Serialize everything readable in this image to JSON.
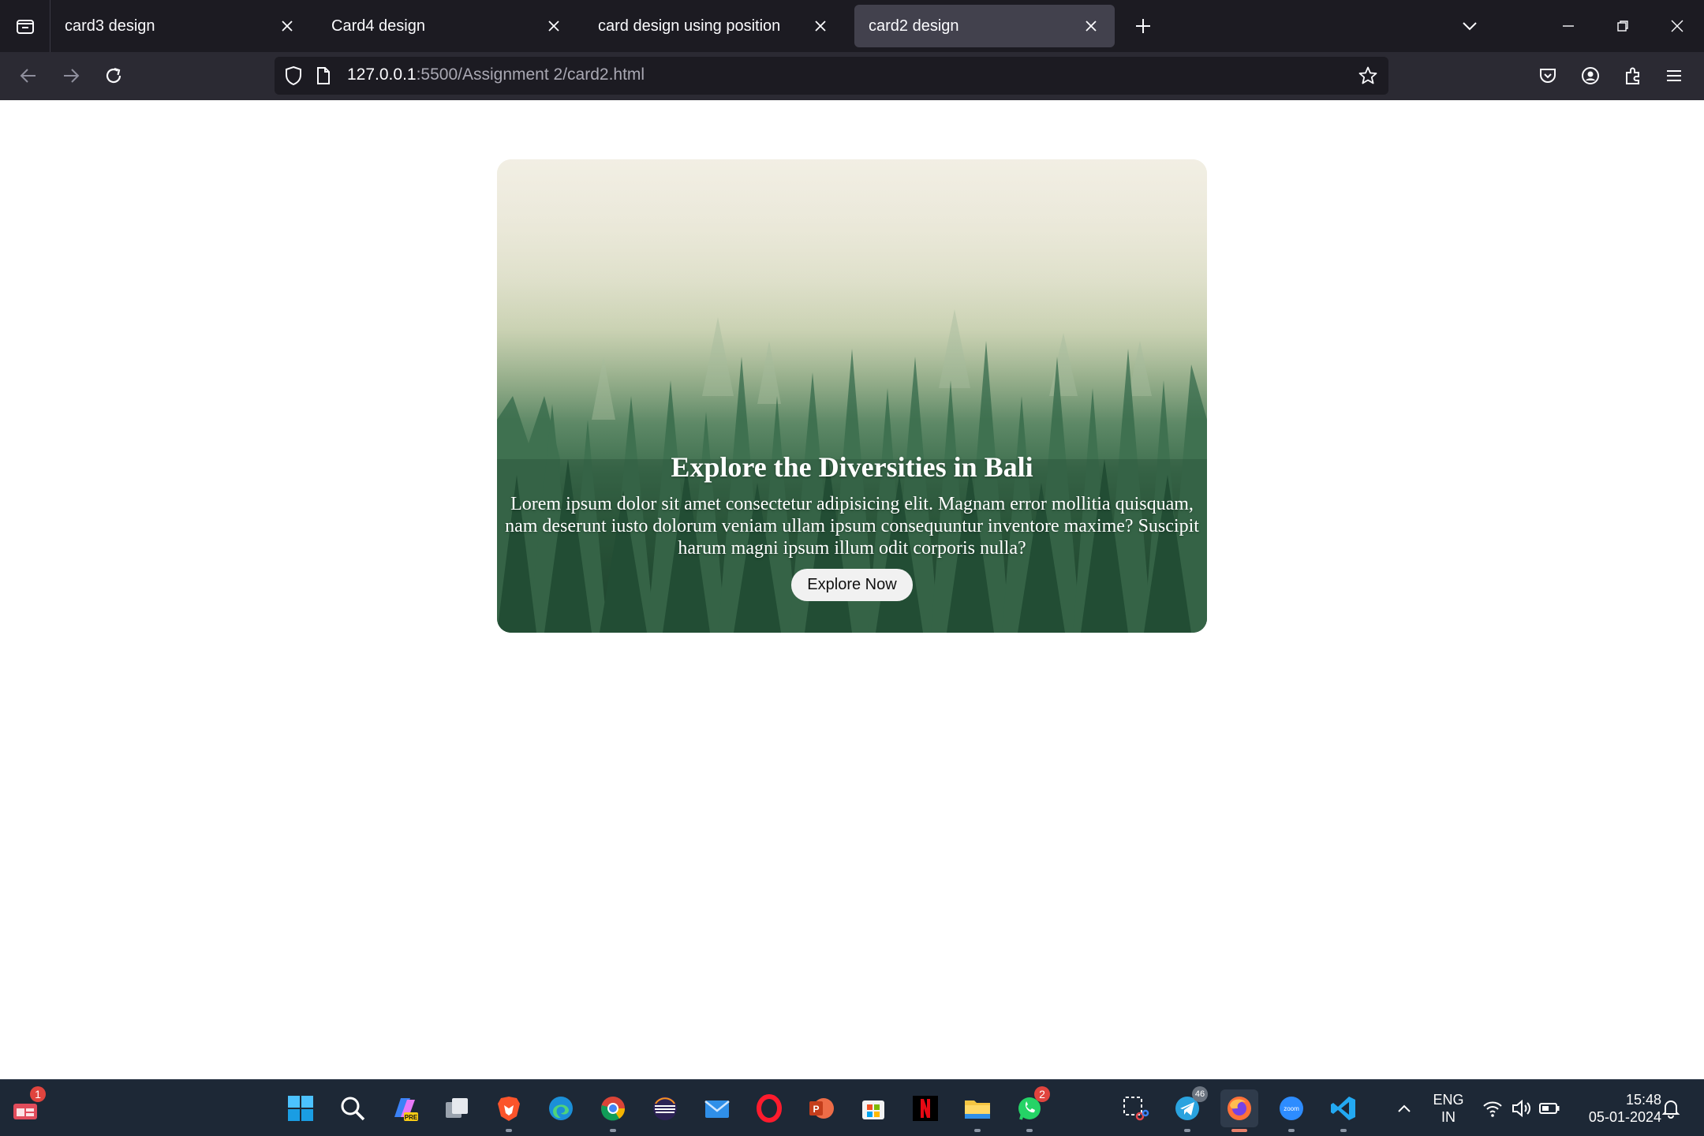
{
  "browser": {
    "tabs": [
      {
        "label": "card3 design",
        "active": false
      },
      {
        "label": "Card4 design",
        "active": false
      },
      {
        "label": "card design using position",
        "active": false
      },
      {
        "label": "card2 design",
        "active": true
      }
    ],
    "url": {
      "host": "127.0.0.1",
      "path": ":5500/Assignment 2/card2.html"
    }
  },
  "card": {
    "title": "Explore the Diversities in Bali",
    "text": "Lorem ipsum dolor sit amet consectetur adipisicing elit. Magnam error mollitia quisquam, nam deserunt iusto dolorum veniam ullam ipsum consequuntur inventore maxime? Suscipit harum magni ipsum illum odit corporis nulla?",
    "button": "Explore Now"
  },
  "taskbar": {
    "widgets_badge": "1",
    "whatsapp_badge": "2",
    "telegram_badge": "46",
    "lang_line1": "ENG",
    "lang_line2": "IN",
    "time": "15:48",
    "date": "05-01-2024"
  },
  "colors": {
    "tabbar_bg": "#1c1b22",
    "navbar_bg": "#2b2a33",
    "active_tab": "#42414d",
    "taskbar_bg": "#1d2836"
  }
}
